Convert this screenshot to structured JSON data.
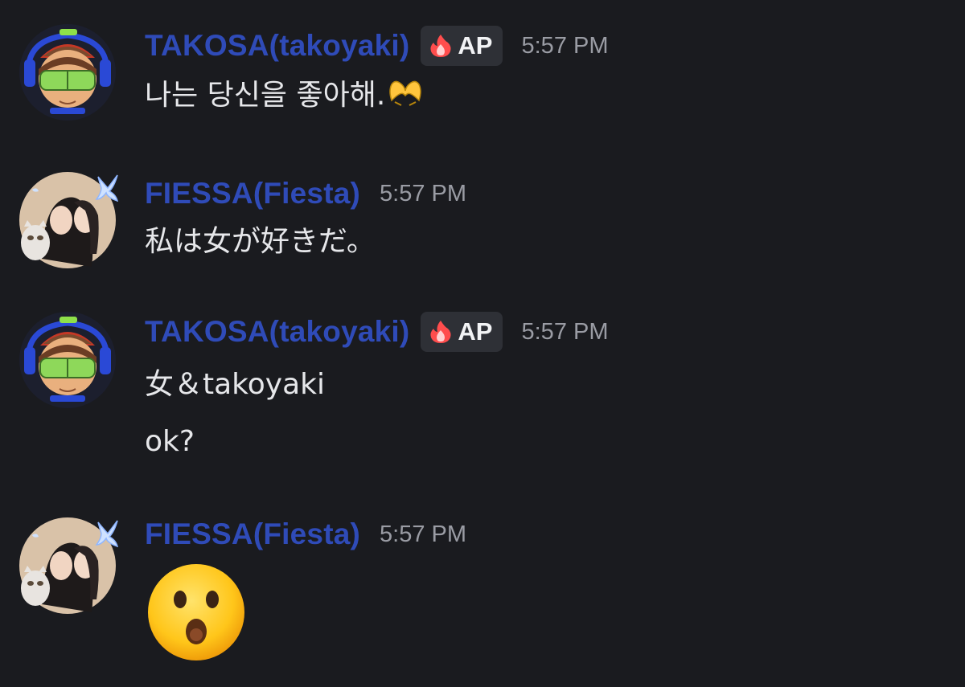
{
  "colors": {
    "background": "#1a1b1f",
    "username": "#2f4bb8",
    "timestamp": "#9a9ca4",
    "message_text": "#e6e7ea",
    "badge_bg": "#2e3036"
  },
  "messages": [
    {
      "username": "TAKOSA(takoyaki)",
      "badge": {
        "icon": "fire-icon",
        "text": "AP"
      },
      "timestamp": "5:57 PM",
      "lines": [
        "나는 당신을 좋아해."
      ],
      "inline_emoji": "heart-hands-emoji"
    },
    {
      "username": "FIESSA(Fiesta)",
      "timestamp": "5:57 PM",
      "lines": [
        "私は女が好きだ。"
      ]
    },
    {
      "username": "TAKOSA(takoyaki)",
      "badge": {
        "icon": "fire-icon",
        "text": "AP"
      },
      "timestamp": "5:57 PM",
      "lines": [
        "女＆takoyaki",
        "ok?"
      ]
    },
    {
      "username": "FIESSA(Fiesta)",
      "timestamp": "5:57 PM",
      "lines": [],
      "big_emoji": "astonished-face-emoji"
    }
  ]
}
